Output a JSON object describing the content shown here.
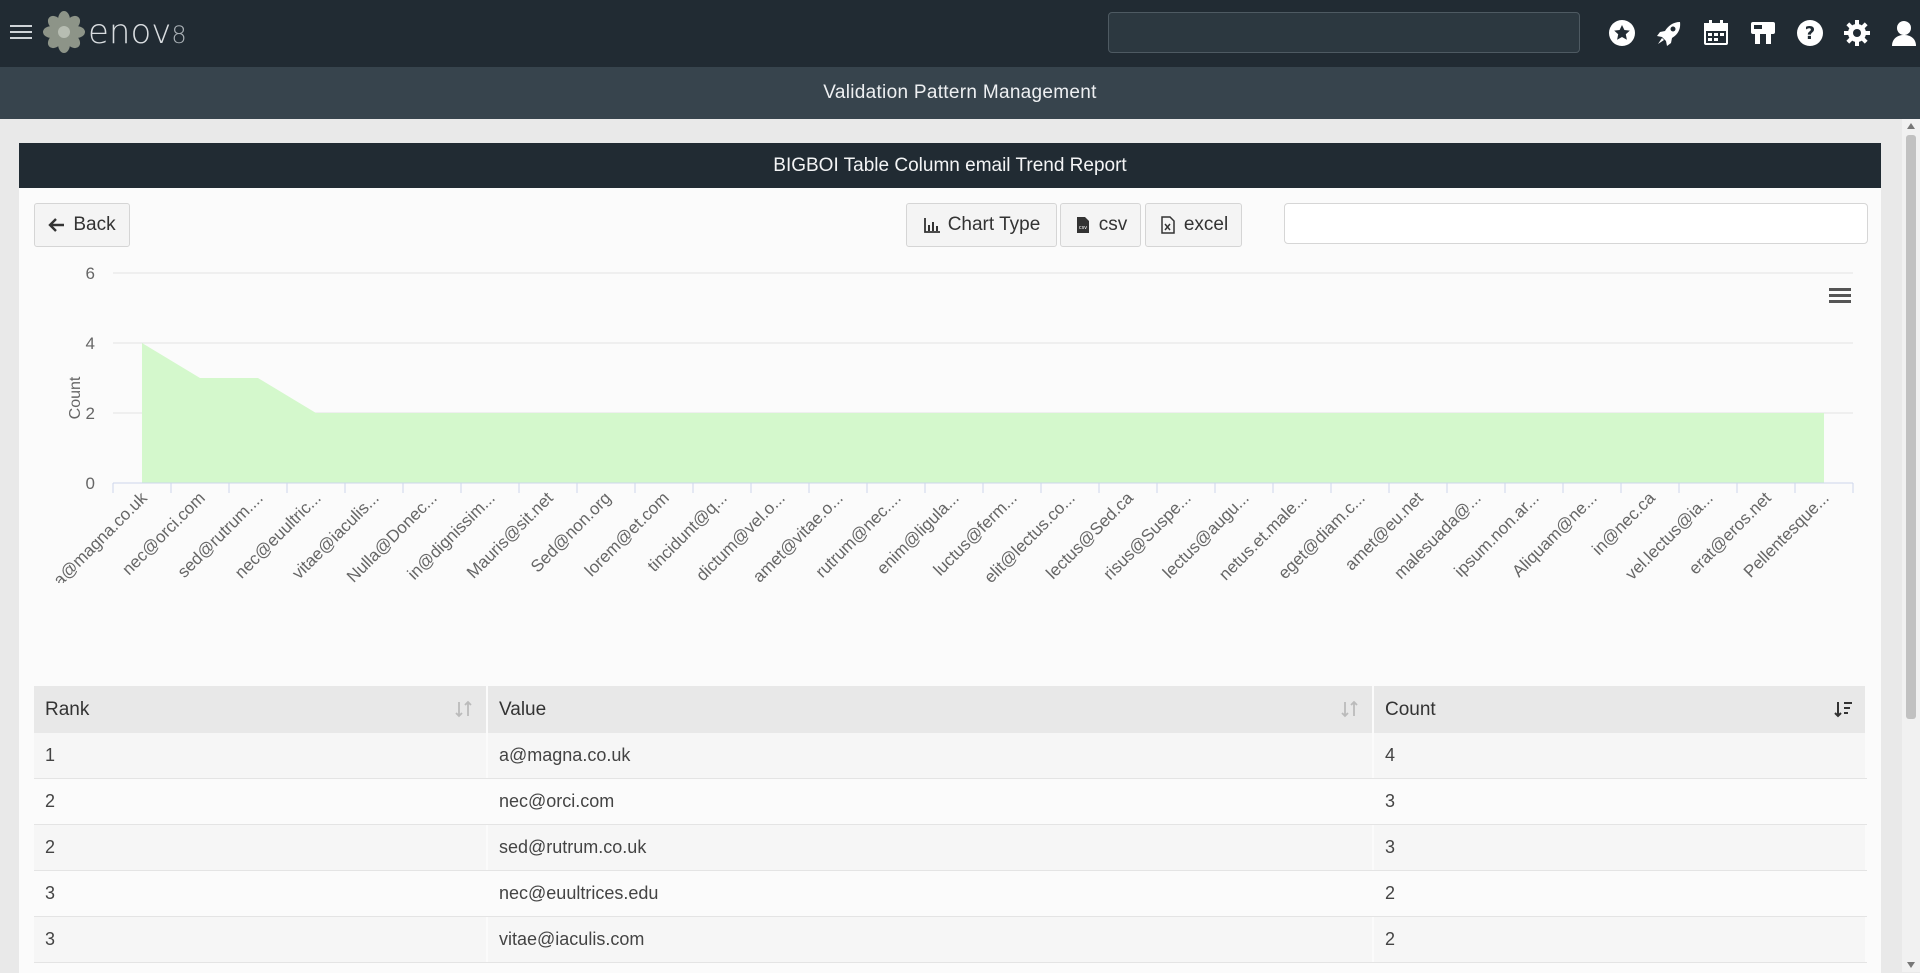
{
  "app": {
    "logo_text": "enov",
    "logo_suffix": "8"
  },
  "header": {
    "icons": [
      "star-icon",
      "rocket-icon",
      "calendar-icon",
      "tool-icon",
      "help-icon",
      "gear-icon",
      "user-icon"
    ]
  },
  "page_title": "Validation Pattern Management",
  "panel": {
    "title": "BIGBOI Table Column email Trend Report",
    "back_label": "Back",
    "chart_type_label": "Chart Type",
    "csv_label": "csv",
    "excel_label": "excel",
    "filter_placeholder": ""
  },
  "chart_data": {
    "type": "area",
    "ylabel": "Count",
    "ylim": [
      0,
      6
    ],
    "yticks": [
      0,
      2,
      4,
      6
    ],
    "color": "#d4f8cc",
    "categories": [
      "a@magna.co.uk",
      "nec@orci.com",
      "sed@rutrum....",
      "nec@euultric...",
      "vitae@iaculis...",
      "Nulla@Donec...",
      "in@dignissim...",
      "Mauris@sit.net",
      "Sed@non.org",
      "lorem@et.com",
      "tincidunt@q...",
      "dictum@vel.o...",
      "amet@vitae.o...",
      "rutrum@nec....",
      "enim@ligula...",
      "luctus@ferm...",
      "elit@lectus.co...",
      "lectus@Sed.ca",
      "risus@Suspe...",
      "lectus@augu...",
      "netus.et.male...",
      "eget@diam.c...",
      "amet@eu.net",
      "malesuada@...",
      "ipsum.non.ar...",
      "Aliquam@ne...",
      "in@nec.ca",
      "vel.lectus@ia...",
      "erat@eros.net",
      "Pellentesque..."
    ],
    "values": [
      4,
      3,
      3,
      2,
      2,
      2,
      2,
      2,
      2,
      2,
      2,
      2,
      2,
      2,
      2,
      2,
      2,
      2,
      2,
      2,
      2,
      2,
      2,
      2,
      2,
      2,
      2,
      2,
      2,
      2
    ]
  },
  "table": {
    "headers": [
      "Rank",
      "Value",
      "Count"
    ],
    "rows": [
      [
        "1",
        "a@magna.co.uk",
        "4"
      ],
      [
        "2",
        "nec@orci.com",
        "3"
      ],
      [
        "2",
        "sed@rutrum.co.uk",
        "3"
      ],
      [
        "3",
        "nec@euultrices.edu",
        "2"
      ],
      [
        "3",
        "vitae@iaculis.com",
        "2"
      ]
    ]
  }
}
